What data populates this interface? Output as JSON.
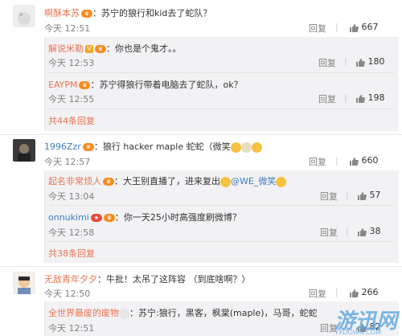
{
  "comments": [
    {
      "user": "啊酥本苏",
      "text": "：苏宁的狼行和kid去了蛇队？",
      "time": "今天 12:51",
      "reply_label": "回复",
      "likes": "667",
      "replies": [
        {
          "user": "解说米勒",
          "text": "：你也是个鬼才。。",
          "time": "今天 12:53",
          "reply_label": "回复",
          "likes": "180"
        },
        {
          "user": "EAYPM",
          "text": "：苏宁得狼行带着电脑去了蛇队，ok？",
          "time": "今天 12:55",
          "reply_label": "回复",
          "likes": "198"
        }
      ],
      "more": "共44条回复"
    },
    {
      "user": "1996Zzr",
      "text": "：狼行 hacker maple 蛇蛇（微笑",
      "time": "今天 12:57",
      "reply_label": "回复",
      "likes": "660",
      "replies": [
        {
          "user": "起名非常烦人",
          "text": "：大王别直播了，进来复出",
          "mention": "@WE_微笑",
          "time": "今天 13:04",
          "reply_label": "回复",
          "likes": "57"
        },
        {
          "user": "onnukimi",
          "text": "：你一天25小时高强度刷微博？",
          "time": "今天 12:58",
          "reply_label": "回复",
          "likes": "38"
        }
      ],
      "more": "共38条回复"
    },
    {
      "user": "无敌青年夕夕",
      "text": "：牛批！太吊了这阵容 （到底啥啊？）",
      "time": "今天 12:50",
      "reply_label": "回复",
      "likes": "266",
      "replies": [
        {
          "user": "全世界最废的废物",
          "text": "：苏宁:狼行，黑客，枫棠(maple)，马哥，蛇蛇",
          "time": "今天 12:51",
          "reply_label": "回复",
          "likes": "82"
        }
      ]
    }
  ],
  "watermark": {
    "text": "游迅网",
    "sub": "YXDOWN.COM"
  },
  "colors": {
    "username": "#eb7350",
    "link": "#3e7cc2",
    "reply_bg": "#f2f2f5"
  }
}
